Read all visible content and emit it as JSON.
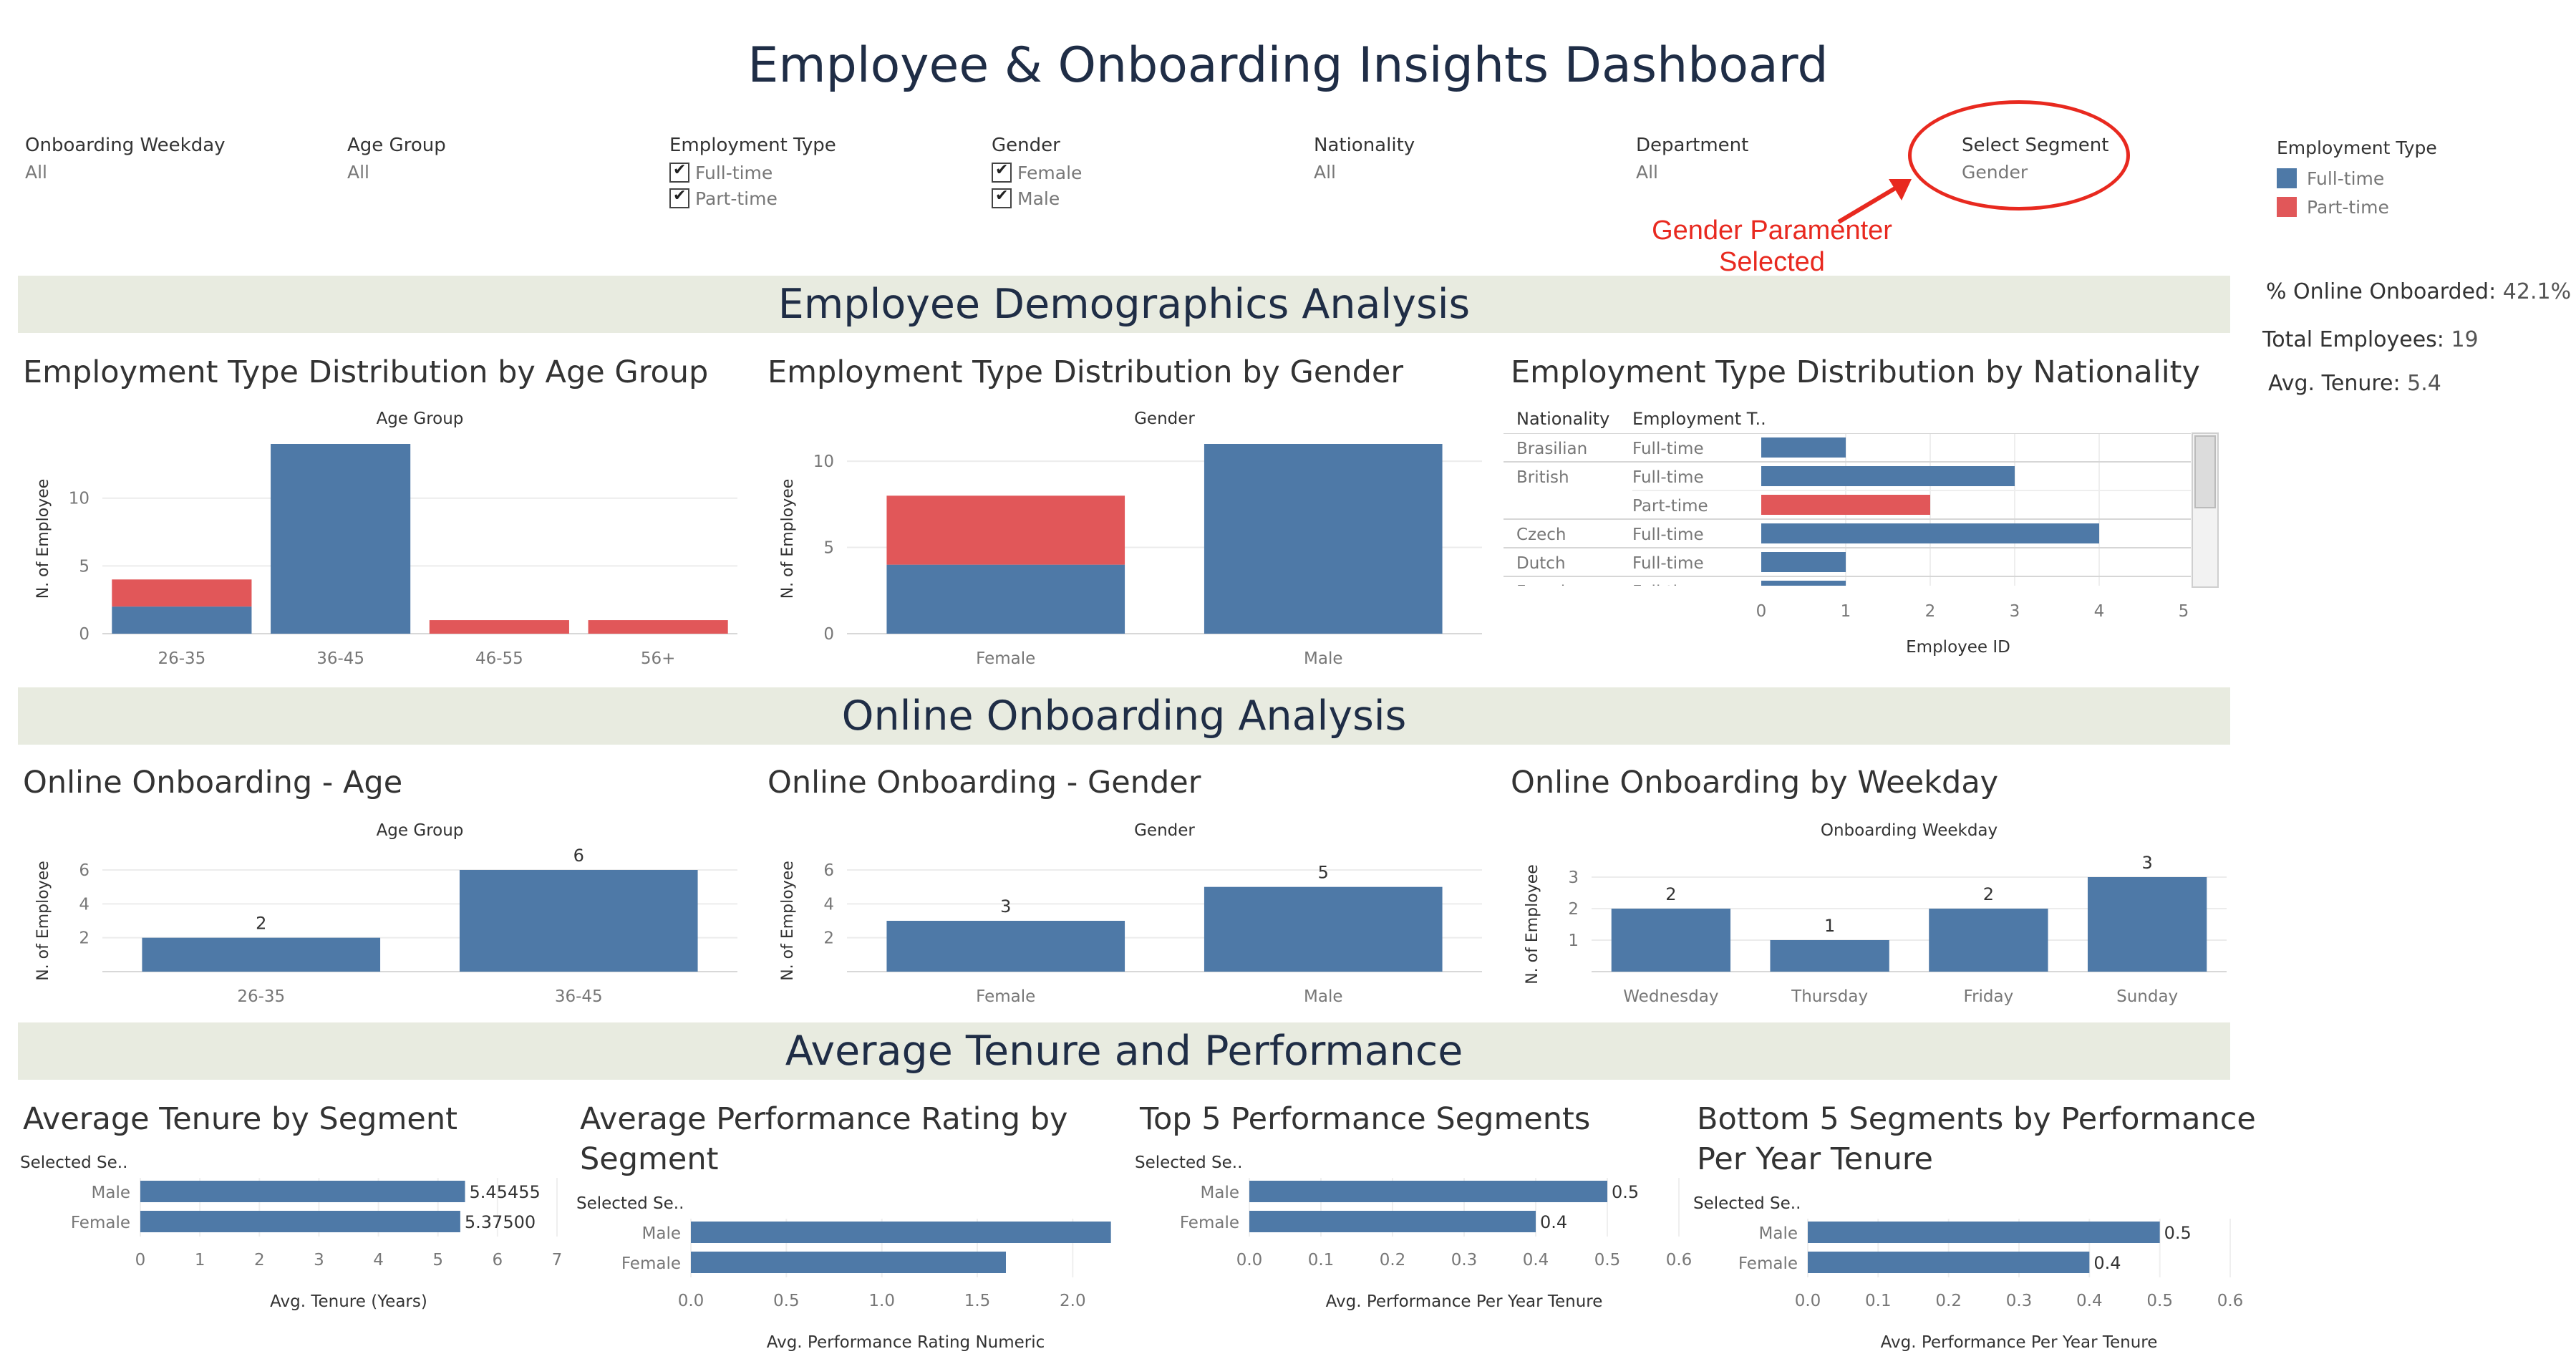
{
  "dashboard": {
    "title": "Employee & Onboarding Insights Dashboard",
    "colors": {
      "full_time": "#4e79a7",
      "part_time": "#e15759",
      "band": "#e8ebe0",
      "annotation": "#e8291f"
    }
  },
  "filters": [
    {
      "label": "Onboarding Weekday",
      "value": "All"
    },
    {
      "label": "Age Group",
      "value": "All"
    },
    {
      "label": "Employment Type",
      "options": [
        "Full-time",
        "Part-time"
      ]
    },
    {
      "label": "Gender",
      "options": [
        "Female",
        "Male"
      ]
    },
    {
      "label": "Nationality",
      "value": "All"
    },
    {
      "label": "Department",
      "value": "All"
    },
    {
      "label": "Select Segment",
      "value": "Gender"
    }
  ],
  "annotation": {
    "line1": "Gender Paramenter",
    "line2": "Selected"
  },
  "legend": {
    "title": "Employment Type",
    "items": [
      "Full-time",
      "Part-time"
    ]
  },
  "kpis": {
    "online_label": "% Online Onboarded:",
    "online_value": "42.1%",
    "total_label": "Total Employees:",
    "total_value": "19",
    "tenure_label": "Avg. Tenure:",
    "tenure_value": "5.4"
  },
  "sections": {
    "demographics": "Employee Demographics Analysis",
    "online": "Online Onboarding Analysis",
    "tenure": "Average Tenure and Performance"
  },
  "chart_titles": {
    "age": "Employment Type Distribution by Age Group",
    "gender": "Employment Type Distribution by Gender",
    "nationality": "Employment Type Distribution by Nationality",
    "online_age": "Online Onboarding - Age",
    "online_gender": "Online Onboarding - Gender",
    "online_weekday": "Online Onboarding by Weekday",
    "tenure": "Average Tenure by Segment",
    "perf_line1": "Average Performance Rating by",
    "perf_line2": "Segment",
    "top5": "Top 5 Performance Segments",
    "bottom_line1": "Bottom 5 Segments by Performance",
    "bottom_line2": "Per Year Tenure"
  },
  "chart_data": [
    {
      "id": "age",
      "type": "bar",
      "stacked": true,
      "header": "Age Group",
      "ylabel": "N. of Employee",
      "categories": [
        "26-35",
        "36-45",
        "46-55",
        "56+"
      ],
      "ylim": [
        0,
        14
      ],
      "yticks": [
        0,
        5,
        10
      ],
      "series": [
        {
          "name": "Full-time",
          "values": [
            2,
            14,
            0,
            0
          ]
        },
        {
          "name": "Part-time",
          "values": [
            2,
            0,
            1,
            1
          ]
        }
      ]
    },
    {
      "id": "gender",
      "type": "bar",
      "stacked": true,
      "header": "Gender",
      "ylabel": "N. of Employee",
      "categories": [
        "Female",
        "Male"
      ],
      "ylim": [
        0,
        11
      ],
      "yticks": [
        0,
        5,
        10
      ],
      "series": [
        {
          "name": "Full-time",
          "values": [
            4,
            11
          ]
        },
        {
          "name": "Part-time",
          "values": [
            4,
            0
          ]
        }
      ]
    },
    {
      "id": "nationality",
      "type": "bar",
      "orientation": "horizontal",
      "col_headers": [
        "Nationality",
        "Employment T.."
      ],
      "xlabel": "Employee ID",
      "xlim": [
        0,
        5
      ],
      "xticks": [
        0,
        1,
        2,
        3,
        4,
        5
      ],
      "rows": [
        {
          "nationality": "Brasilian",
          "type": "Full-time",
          "value": 1
        },
        {
          "nationality": "British",
          "type": "Full-time",
          "value": 3
        },
        {
          "nationality": "",
          "type": "Part-time",
          "value": 2
        },
        {
          "nationality": "Czech",
          "type": "Full-time",
          "value": 4
        },
        {
          "nationality": "Dutch",
          "type": "Full-time",
          "value": 1
        },
        {
          "nationality": "French",
          "type": "Full-time",
          "value": 1
        }
      ]
    },
    {
      "id": "online_age",
      "type": "bar",
      "header": "Age Group",
      "ylabel": "N. of Employee",
      "categories": [
        "26-35",
        "36-45"
      ],
      "values": [
        2,
        6
      ],
      "ylim": [
        0,
        6
      ],
      "yticks": [
        2,
        4,
        6
      ]
    },
    {
      "id": "online_gender",
      "type": "bar",
      "header": "Gender",
      "ylabel": "N. of Employee",
      "categories": [
        "Female",
        "Male"
      ],
      "values": [
        3,
        5
      ],
      "ylim": [
        0,
        6
      ],
      "yticks": [
        2,
        4,
        6
      ]
    },
    {
      "id": "online_weekday",
      "type": "bar",
      "header": "Onboarding Weekday",
      "ylabel": "N. of Employee",
      "categories": [
        "Wednesday",
        "Thursday",
        "Friday",
        "Sunday"
      ],
      "values": [
        2,
        1,
        2,
        3
      ],
      "ylim": [
        0,
        3
      ],
      "yticks": [
        1,
        2,
        3
      ]
    },
    {
      "id": "tenure",
      "type": "bar",
      "orientation": "horizontal",
      "row_header": "Selected Se..",
      "xlabel": "Avg. Tenure (Years)",
      "categories": [
        "Male",
        "Female"
      ],
      "values": [
        5.45455,
        5.375
      ],
      "labels": [
        "5.45455",
        "5.37500"
      ],
      "xlim": [
        0,
        7
      ],
      "xticks": [
        "0",
        "1",
        "2",
        "3",
        "4",
        "5",
        "6",
        "7"
      ]
    },
    {
      "id": "perf",
      "type": "bar",
      "orientation": "horizontal",
      "row_header": "Selected Se..",
      "xlabel": "Avg. Performance Rating Numeric",
      "categories": [
        "Male",
        "Female"
      ],
      "values": [
        2.2,
        1.65
      ],
      "labels": [
        "",
        ""
      ],
      "xlim": [
        0,
        2.25
      ],
      "xticks": [
        "0.0",
        "0.5",
        "1.0",
        "1.5",
        "2.0"
      ]
    },
    {
      "id": "top5",
      "type": "bar",
      "orientation": "horizontal",
      "row_header": "Selected Se..",
      "xlabel": "Avg. Performance Per Year Tenure",
      "categories": [
        "Male",
        "Female"
      ],
      "values": [
        0.5,
        0.4
      ],
      "labels": [
        "0.5",
        "0.4"
      ],
      "xlim": [
        0,
        0.6
      ],
      "xticks": [
        "0.0",
        "0.1",
        "0.2",
        "0.3",
        "0.4",
        "0.5",
        "0.6"
      ]
    },
    {
      "id": "bottom5",
      "type": "bar",
      "orientation": "horizontal",
      "row_header": "Selected Se..",
      "xlabel": "Avg. Performance Per Year Tenure",
      "categories": [
        "Male",
        "Female"
      ],
      "values": [
        0.5,
        0.4
      ],
      "labels": [
        "0.5",
        "0.4"
      ],
      "xlim": [
        0,
        0.6
      ],
      "xticks": [
        "0.0",
        "0.1",
        "0.2",
        "0.3",
        "0.4",
        "0.5",
        "0.6"
      ]
    }
  ]
}
